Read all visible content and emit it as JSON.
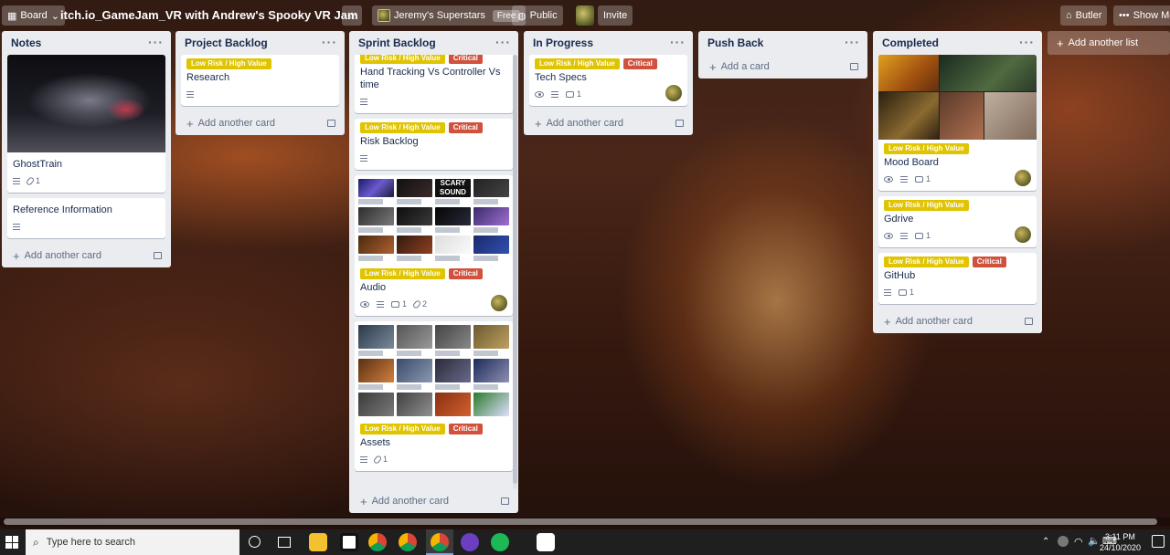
{
  "header": {
    "board_menu": "Board",
    "title": "itch.io_GameJam_VR with Andrew's Spooky VR Jam",
    "team": "Jeremy's Superstars",
    "team_badge": "Free",
    "visibility": "Public",
    "invite": "Invite",
    "butler": "Butler",
    "show_menu": "Show Me"
  },
  "label_text": {
    "yellow": "Low Risk / High Value",
    "red": "Critical"
  },
  "lists": {
    "notes": {
      "title": "Notes",
      "cards": [
        {
          "title": "GhostTrain",
          "attachments": "1"
        },
        {
          "title": "Reference Information"
        }
      ],
      "add": "Add another card"
    },
    "backlog": {
      "title": "Project Backlog",
      "cards": [
        {
          "title": "Research"
        }
      ],
      "add": "Add another card"
    },
    "sprint": {
      "title": "Sprint Backlog",
      "cards": [
        {
          "title": "Hand Tracking Vs Controller Vs time"
        },
        {
          "title": "Risk Backlog"
        },
        {
          "title": "Audio",
          "comments": "1",
          "attachments": "2",
          "cover_text": "SCARY SOUND"
        },
        {
          "title": "Assets",
          "attachments": "1"
        }
      ],
      "add": "Add another card"
    },
    "inprogress": {
      "title": "In Progress",
      "cards": [
        {
          "title": "Tech Specs",
          "comments": "1"
        }
      ],
      "add": "Add another card"
    },
    "pushback": {
      "title": "Push Back",
      "add": "Add a card"
    },
    "completed": {
      "title": "Completed",
      "cards": [
        {
          "title": "Mood Board",
          "comments": "1"
        },
        {
          "title": "Gdrive",
          "comments": "1"
        },
        {
          "title": "GitHub",
          "comments": "1"
        }
      ],
      "add": "Add another card"
    }
  },
  "add_list": "Add another list",
  "taskbar": {
    "search_placeholder": "Type here to search",
    "time": "3:11 PM",
    "date": "24/10/2020"
  }
}
